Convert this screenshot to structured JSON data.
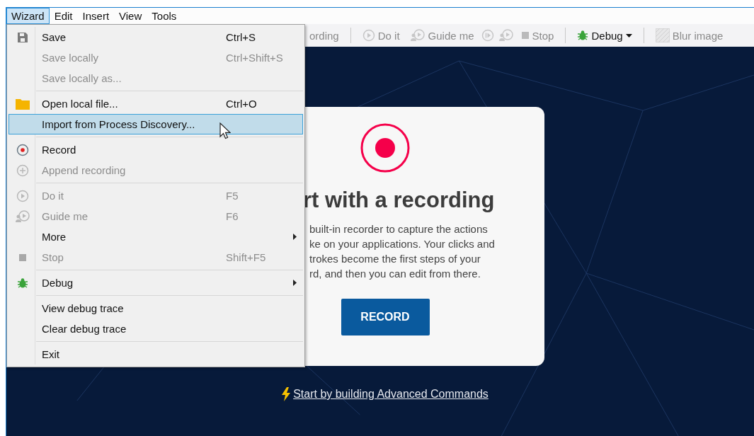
{
  "menu_bar": [
    {
      "label": "Wizard",
      "selected": true
    },
    {
      "label": "Edit",
      "selected": false
    },
    {
      "label": "Insert",
      "selected": false
    },
    {
      "label": "View",
      "selected": false
    },
    {
      "label": "Tools",
      "selected": false
    }
  ],
  "toolbar": [
    {
      "kind": "text",
      "label": "ording",
      "disabled": true
    },
    {
      "kind": "separator"
    },
    {
      "kind": "button",
      "label": "Do it",
      "disabled": true
    },
    {
      "kind": "button",
      "label": "Guide me",
      "disabled": true
    },
    {
      "kind": "icon",
      "disabled": true
    },
    {
      "kind": "icon",
      "disabled": true
    },
    {
      "kind": "button",
      "label": "Stop",
      "disabled": true
    },
    {
      "kind": "separator"
    },
    {
      "kind": "dropdown",
      "label": "Debug",
      "disabled": false
    },
    {
      "kind": "separator"
    },
    {
      "kind": "button",
      "label": "Blur image",
      "disabled": true
    }
  ],
  "menu": [
    {
      "kind": "item",
      "label": "Save",
      "shortcut": "Ctrl+S",
      "disabled": false,
      "selected": false,
      "submenu": false
    },
    {
      "kind": "item",
      "label": "Save locally",
      "shortcut": "Ctrl+Shift+S",
      "disabled": true,
      "selected": false,
      "submenu": false
    },
    {
      "kind": "item",
      "label": "Save locally as...",
      "disabled": true,
      "selected": false,
      "submenu": false
    },
    {
      "kind": "separator"
    },
    {
      "kind": "item",
      "label": "Open local file...",
      "shortcut": "Ctrl+O",
      "disabled": false,
      "selected": false,
      "submenu": false
    },
    {
      "kind": "item",
      "label": "Import from Process Discovery...",
      "disabled": false,
      "selected": true,
      "submenu": false
    },
    {
      "kind": "separator"
    },
    {
      "kind": "item",
      "label": "Record",
      "disabled": false,
      "selected": false,
      "submenu": false
    },
    {
      "kind": "item",
      "label": "Append recording",
      "disabled": true,
      "selected": false,
      "submenu": false
    },
    {
      "kind": "separator"
    },
    {
      "kind": "item",
      "label": "Do it",
      "shortcut": "F5",
      "disabled": true,
      "selected": false,
      "submenu": false
    },
    {
      "kind": "item",
      "label": "Guide me",
      "shortcut": "F6",
      "disabled": true,
      "selected": false,
      "submenu": false
    },
    {
      "kind": "item",
      "label": "More",
      "disabled": false,
      "selected": false,
      "submenu": true
    },
    {
      "kind": "item",
      "label": "Stop",
      "shortcut": "Shift+F5",
      "disabled": true,
      "selected": false,
      "submenu": false
    },
    {
      "kind": "separator"
    },
    {
      "kind": "item",
      "label": "Debug",
      "disabled": false,
      "selected": false,
      "submenu": true
    },
    {
      "kind": "separator"
    },
    {
      "kind": "item",
      "label": "View debug trace",
      "disabled": false,
      "selected": false,
      "submenu": false
    },
    {
      "kind": "item",
      "label": "Clear debug trace",
      "disabled": false,
      "selected": false,
      "submenu": false
    },
    {
      "kind": "separator"
    },
    {
      "kind": "item",
      "label": "Exit",
      "disabled": false,
      "selected": false,
      "submenu": false
    }
  ],
  "card": {
    "heading": "rt with a recording",
    "body_lines": [
      "built-in recorder to capture the actions",
      "ke on your applications. Your clicks and",
      "trokes become the first steps of your",
      "rd, and then you can edit from there."
    ],
    "button": "RECORD"
  },
  "link": "Start by building Advanced Commands"
}
